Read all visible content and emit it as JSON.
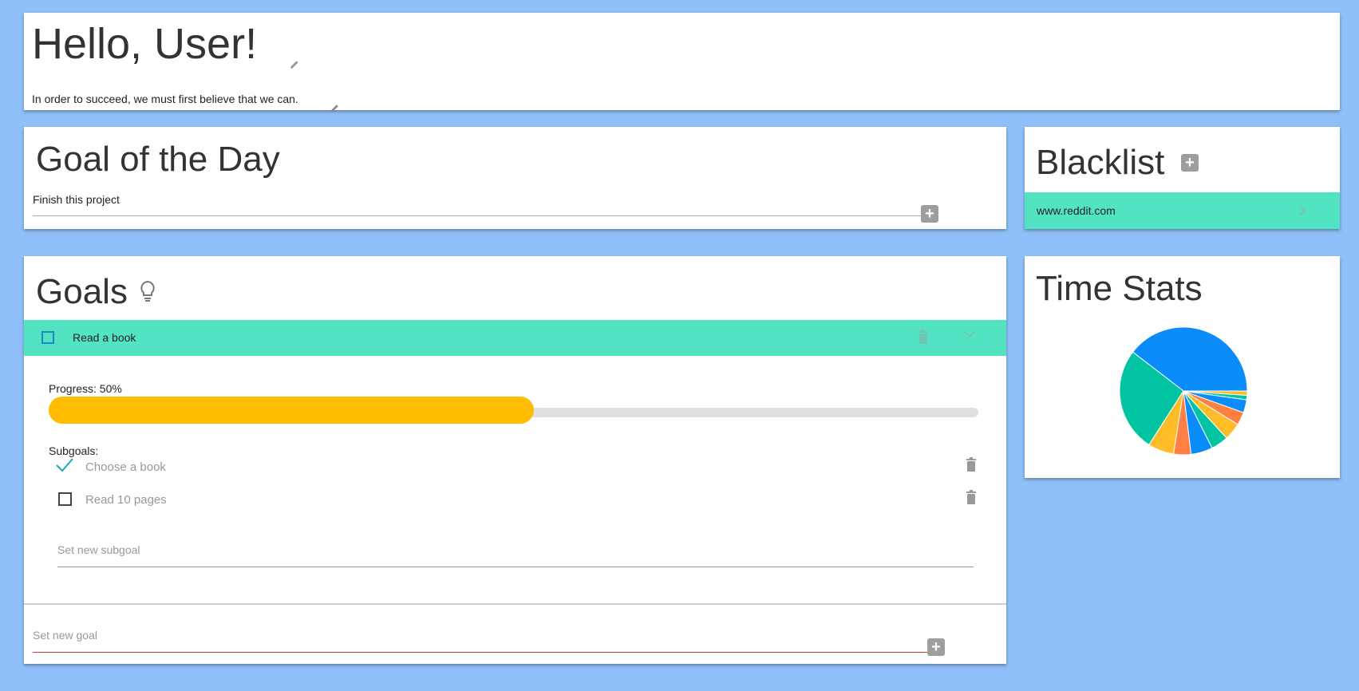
{
  "hello": {
    "title": "Hello, User!",
    "quote": "In order to succeed, we must first believe that we can."
  },
  "goal_of_day": {
    "title": "Goal of the Day",
    "goal": "Finish this project"
  },
  "blacklist": {
    "title": "Blacklist",
    "items": [
      {
        "label": "www.reddit.com"
      }
    ]
  },
  "goals": {
    "title": "Goals",
    "items": [
      {
        "label": "Read a book",
        "progress_label": "Progress: 50%",
        "progress": 0.5,
        "subgoals_label": "Subgoals:",
        "subgoals": [
          {
            "label": "Choose a book",
            "done": true
          },
          {
            "label": "Read 10 pages",
            "done": false
          }
        ],
        "new_subgoal_placeholder": "Set new subgoal"
      }
    ],
    "new_goal_placeholder": "Set new goal"
  },
  "time_stats": {
    "title": "Time Stats",
    "chart_data": {
      "type": "pie",
      "values": [
        36,
        24,
        6,
        4,
        5,
        4,
        4,
        3,
        3,
        1,
        1
      ],
      "colors": [
        "#0a8cfb",
        "#00c4a2",
        "#ffbb28",
        "#ff8042",
        "#0a8cfb",
        "#00c4a2",
        "#ffbb28",
        "#ff8042",
        "#0a8cfb",
        "#00c4a2",
        "#ffbb28"
      ]
    }
  },
  "colors": {
    "background": "#90c0f9",
    "accent": "#52e3c2",
    "progress": "#ffbc00"
  }
}
